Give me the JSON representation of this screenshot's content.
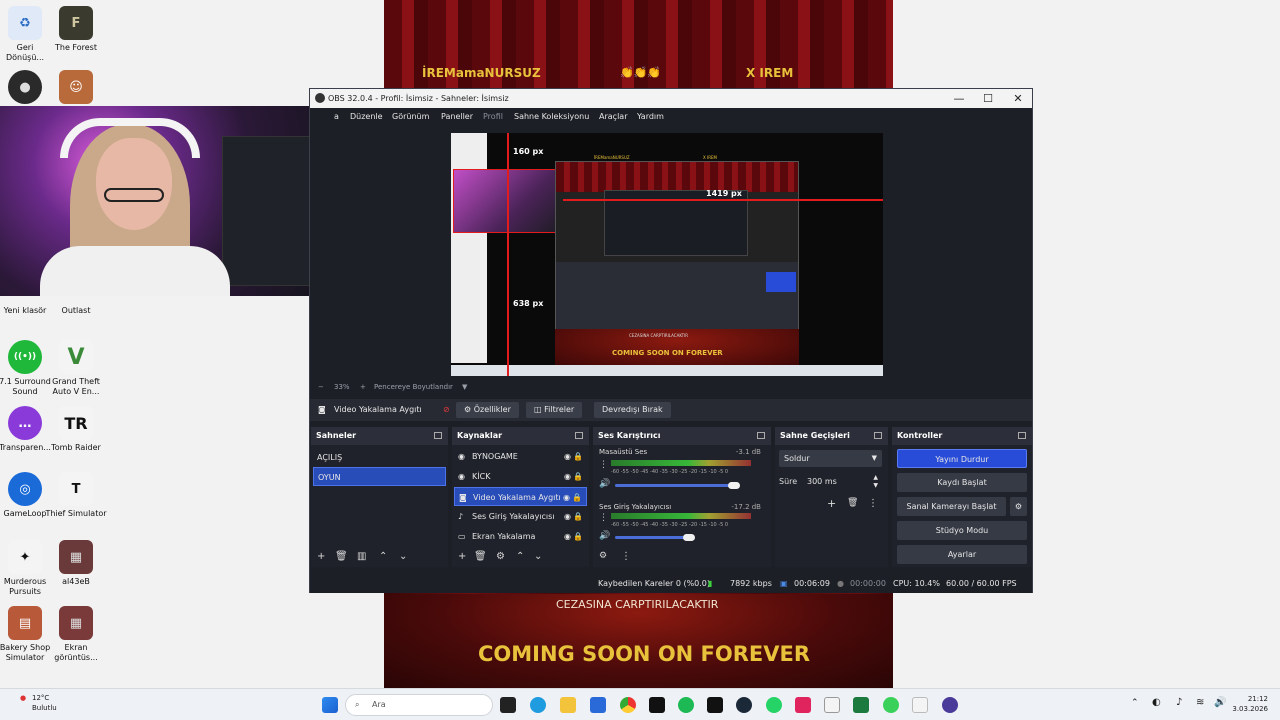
{
  "desktop": {
    "icons": [
      {
        "label": "Geri\nDönüşü...",
        "glyph": "♻"
      },
      {
        "label": "The Forest",
        "glyph": "F"
      },
      {
        "label": "",
        "glyph": "●"
      },
      {
        "label": "",
        "glyph": "☺"
      },
      {
        "label": "Yeni klasör",
        "glyph": "▇"
      },
      {
        "label": "Outlast",
        "glyph": "O"
      },
      {
        "label": "7.1 Surround Sound",
        "glyph": "((•))"
      },
      {
        "label": "Grand Theft Auto V En...",
        "glyph": "V"
      },
      {
        "label": "Transparen...",
        "glyph": "…"
      },
      {
        "label": "Tomb Raider",
        "glyph": "TR"
      },
      {
        "label": "GameLoop",
        "glyph": "◎"
      },
      {
        "label": "Thief Simulator",
        "glyph": "T"
      },
      {
        "label": "Murderous Pursuits",
        "glyph": "✦"
      },
      {
        "label": "al43eB",
        "glyph": "▦"
      },
      {
        "label": "Bakery Shop Simulator",
        "glyph": "▤"
      },
      {
        "label": "Ekran görüntüs...",
        "glyph": "▦"
      }
    ]
  },
  "stream_overlay": {
    "left_name": "İREMamaNURSUZ",
    "emojis": "👏👏👏",
    "right_name": "X IREM",
    "bottom_subtitle": "CEZASINA CARPTIRILACAKTIR",
    "bottom_title": "COMING SOON ON FOREVER"
  },
  "obs": {
    "title": "OBS 32.0.4 - Profil: İsimsiz - Sahneler: İsimsiz",
    "window_buttons": {
      "minimize": "—",
      "maximize": "☐",
      "close": "✕"
    },
    "menu": [
      "a",
      "Düzenle",
      "Görünüm",
      "Paneller",
      "Profil",
      "Sahne Koleksiyonu",
      "Araçlar",
      "Yardım"
    ],
    "preview": {
      "label_top": "160 px",
      "label_right": "1419 px",
      "label_left": "638 px",
      "inner_left_name": "İREMamaNURSUZ",
      "inner_right_name": "X IREM",
      "inner_title": "COMING SOON ON FOREVER",
      "inner_sub": "CEZASINA CARPTIRILACAKTIR"
    },
    "zoom": {
      "minus": "−",
      "value": "33%",
      "plus": "+",
      "fit": "Pencereye Boyutlandır",
      "caret": "▼"
    },
    "source_toolbar": {
      "source_name": "Video Yakalama Aygıtı",
      "properties": "Özellikler",
      "filters": "Filtreler",
      "deactivate": "Devredışı Bırak"
    },
    "scenes": {
      "title": "Sahneler",
      "items": [
        "AÇILIŞ",
        "OYUN"
      ],
      "selected": "OYUN"
    },
    "sources": {
      "title": "Kaynaklar",
      "items": [
        {
          "name": "BYNOGAME",
          "icon": "globe-icon"
        },
        {
          "name": "KİCK",
          "icon": "globe-icon"
        },
        {
          "name": "Video Yakalama Aygıtı",
          "icon": "camera-icon"
        },
        {
          "name": "Ses Giriş Yakalayıcısı",
          "icon": "mic-icon"
        },
        {
          "name": "Ekran Yakalama",
          "icon": "monitor-icon"
        }
      ],
      "selected": "Video Yakalama Aygıtı"
    },
    "mixer": {
      "title": "Ses Karıştırıcı",
      "channels": [
        {
          "name": "Masaüstü Ses",
          "db": "-3.1 dB",
          "level": 0.4,
          "volume": 0.92
        },
        {
          "name": "Ses Giriş Yakalayıcısı",
          "db": "-17.2 dB",
          "level": 0.35,
          "volume": 0.58
        }
      ],
      "scale": [
        "-60",
        "-55",
        "-50",
        "-45",
        "-40",
        "-35",
        "-30",
        "-25",
        "-20",
        "-15",
        "-10",
        "-5",
        "0"
      ]
    },
    "transitions": {
      "title": "Sahne Geçişleri",
      "type": "Soldur",
      "duration_label": "Süre",
      "duration_value": "300 ms"
    },
    "controls": {
      "title": "Kontroller",
      "buttons": [
        "Yayını Durdur",
        "Kaydı Başlat",
        "Sanal Kamerayı Başlat",
        "Stüdyo Modu",
        "Ayarlar"
      ]
    },
    "status": {
      "dropped": "Kaybedilen Kareler 0 (%0.0)",
      "bitrate": "7892 kbps",
      "stream_time": "00:06:09",
      "rec_time": "00:00:00",
      "cpu": "CPU: 10.4%",
      "fps": "60.00 / 60.00 FPS"
    }
  },
  "taskbar": {
    "weather_temp": "12°C",
    "weather_desc": "Bulutlu",
    "search_placeholder": "Ara",
    "time": "21:12",
    "date": "3.03.2026"
  },
  "colors": {
    "obs_bg": "#1d1f26",
    "dock_bg": "#272a33",
    "accent": "#284cd8",
    "overlay_gold": "#e9c23c",
    "curtain_red": "#6e0d10"
  }
}
